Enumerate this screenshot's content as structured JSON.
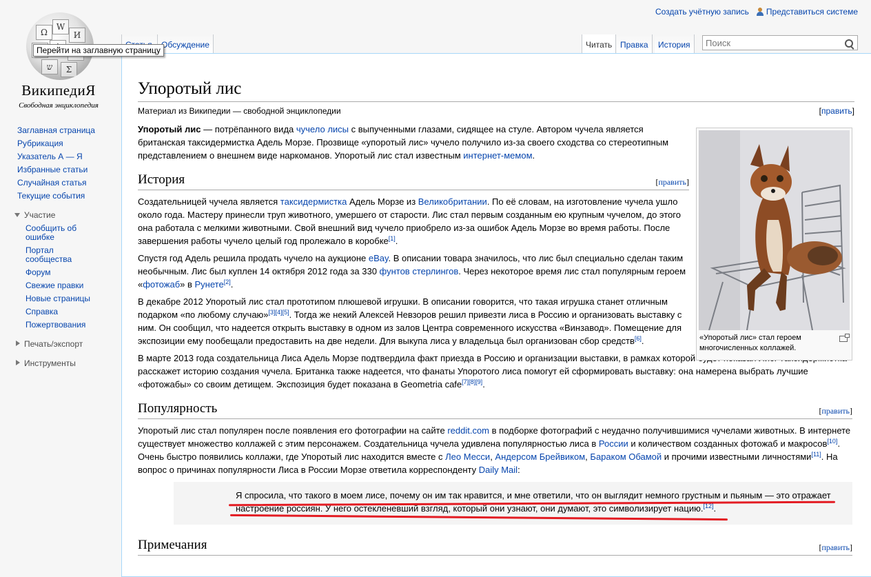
{
  "personal": {
    "create_account": "Создать учётную запись",
    "login": "Представиться системе"
  },
  "logo": {
    "wordmark": "ВикипедиЯ",
    "tagline": "Свободная энциклопедия",
    "tooltip": "Перейти на заглавную страницу"
  },
  "tabs": {
    "article": "Статья",
    "discussion": "Обсуждение",
    "read": "Читать",
    "edit": "Правка",
    "history": "История"
  },
  "search": {
    "placeholder": "Поиск"
  },
  "sidebar": {
    "main": [
      "Заглавная страница",
      "Рубрикация",
      "Указатель А — Я",
      "Избранные статьи",
      "Случайная статья",
      "Текущие события"
    ],
    "participation": {
      "title": "Участие",
      "items": [
        "Сообщить об ошибке",
        "Портал сообщества",
        "Форум",
        "Свежие правки",
        "Новые страницы",
        "Справка",
        "Пожертвования"
      ]
    },
    "print": "Печать/экспорт",
    "tools": "Инструменты"
  },
  "article": {
    "title": "Упоротый лис",
    "subtitle": "Материал из Википедии — свободной энциклопедии",
    "edit_label": "[править]",
    "edit_l": "[",
    "edit_word": "править",
    "edit_r": "]",
    "intro": {
      "bold": "Упоротый лис",
      "t1": " — потрёпанного вида ",
      "l1": "чучело",
      "t2": " ",
      "l2": "лисы",
      "t3": " с выпученными глазами, сидящее на стуле. Автором чучела является британская таксидермистка Адель Морзе. Прозвище «упоротый лис» чучело получило из-за своего сходства со стереотипным представлением о внешнем виде наркоманов. Упоротый лис стал известным ",
      "l3": "интернет-мемом",
      "t4": "."
    },
    "history": {
      "heading": "История",
      "p1": {
        "t1": "Создательницей чучела является ",
        "l1": "таксидермистка",
        "t2": " Адель Морзе из ",
        "l2": "Великобритании",
        "t3": ". По её словам, на изготовление чучела ушло около года. Мастеру принесли труп животного, умершего от старости. Лис стал первым созданным ею крупным чучелом, до этого она работала с мелкими животными. Свой внешний вид чучело приобрело из-за ошибок Адель Морзе во время работы. После завершения работы чучело целый год пролежало в коробке",
        "r1": "[1]",
        "t4": "."
      },
      "p2": {
        "t1": "Спустя год Адель решила продать чучело на аукционе ",
        "l1": "eBay",
        "t2": ". В описании товара значилось, что лис был специально сделан таким необычным. Лис был куплен 14 октября 2012 года за 330 ",
        "l2": "фунтов стерлингов",
        "t3": ". Через некоторое время лис стал популярным героем «",
        "l3": "фотожаб",
        "t4": "» в ",
        "l4": "Рунете",
        "r1": "[2]",
        "t5": "."
      },
      "p3": {
        "t1": "В декабре 2012 Упоротый лис стал прототипом плюшевой игрушки. В описании говорится, что такая игрушка станет отличным подарком «по любому случаю»",
        "r1": "[3]",
        "r2": "[4]",
        "r3": "[5]",
        "t2": ". Тогда же некий Алексей Невзоров решил привезти лиса в Россию и организовать выставку с ним. Он сообщил, что надеется открыть выставку в одном из залов Центра современного искусства «Винзавод». Помещение для экспозиции ему пообещали предоставить на две недели. Для выкупа лиса у владельца был организован сбор средств",
        "r4": "[6]",
        "t3": "."
      },
      "p4": {
        "t1": "В марте 2013 года создательница Лиса Адель Морзе подтвердила факт приезда в Россию и организации выставки, в рамках которой будет показан Лис. Таксидермистка расскажет историю создания чучела. Британка также надеется, что фанаты Упоротого лиса помогут ей сформировать выставку: она намерена выбрать лучшие «фотожабы» со своим детищем. Экспозиция будет показана в Geometria cafe",
        "r1": "[7]",
        "r2": "[8]",
        "r3": "[9]",
        "t2": "."
      }
    },
    "thumb_caption": "«Упоротый лис» стал героем многочисленных коллажей.",
    "popularity": {
      "heading": "Популярность",
      "p1": {
        "t1": "Упоротый лис стал популярен после появления его фотографии на сайте ",
        "l1": "reddit.com",
        "t2": " в подборке фотографий с неудачно получившимися чучелами животных. В интернете существует множество коллажей с этим персонажем. Создательница чучела удивлена популярностью лиса в ",
        "l2": "России",
        "t3": " и количеством созданных фотожаб и макросов",
        "r1": "[10]",
        "t4": ". Очень быстро появились коллажи, где Упоротый лис находится вместе с ",
        "l3": "Лео Месси",
        "t5": ", ",
        "l4": "Андерсом Брейвиком",
        "t6": ", ",
        "l5": "Бараком Обамой",
        "t7": " и прочими известными личностями",
        "r2": "[11]",
        "t8": ". На вопрос о причинах популярности Лиса в России Морзе ответила корреспонденту ",
        "l6": "Daily Mail",
        "t9": ":"
      },
      "quote": {
        "t1": "Я спросила, что такого в моем лисе, почему он им так нравится, и мне ответили, что он выглядит немного грустным и пьяным — это отражает настроение россиян. У него остекленевший взгляд, который они узнают, они думают, это символизирует нацию.",
        "r1": "[12]",
        "t2": "."
      }
    },
    "notes_heading": "Примечания"
  }
}
